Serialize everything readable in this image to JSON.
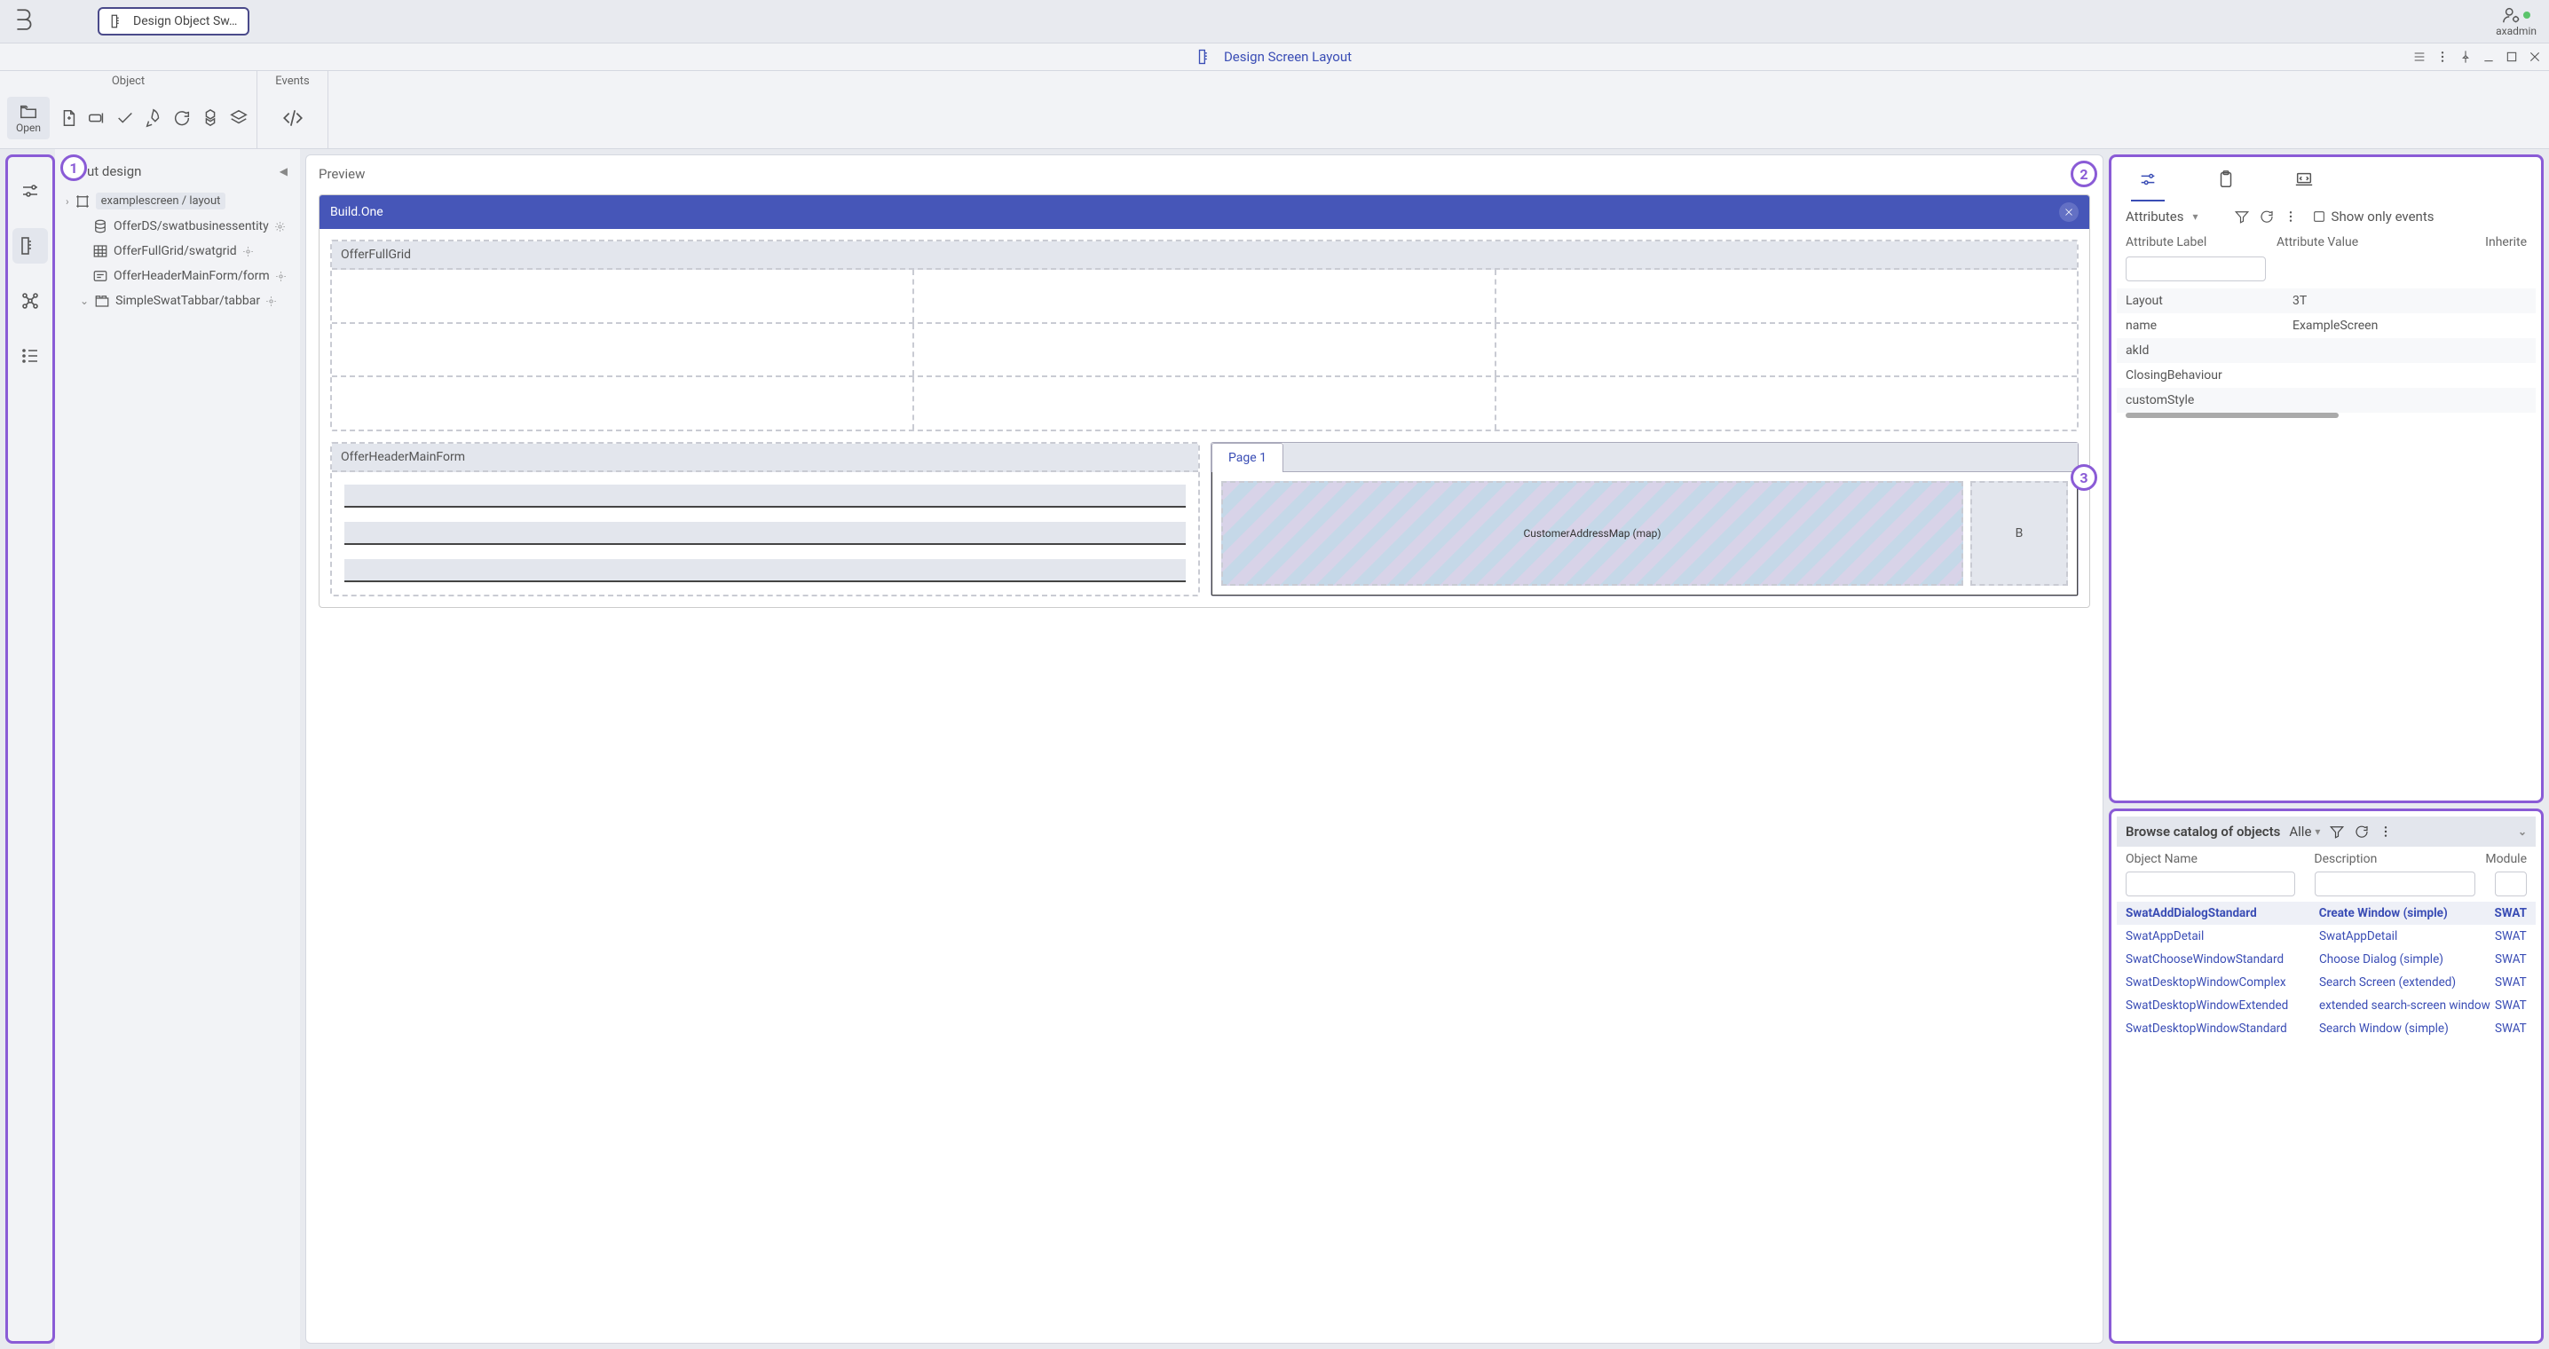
{
  "topbar": {
    "tab_label": "Design Object Sw…",
    "username": "axadmin"
  },
  "titlebar": {
    "title": "Design Screen Layout"
  },
  "ribbon": {
    "object_label": "Object",
    "open_label": "Open",
    "events_label": "Events"
  },
  "tree": {
    "header": "ut design",
    "nodes": [
      {
        "label": "examplescreen / layout"
      },
      {
        "label": "OfferDS/swatbusinessentity"
      },
      {
        "label": "OfferFullGrid/swatgrid"
      },
      {
        "label": "OfferHeaderMainForm/form"
      },
      {
        "label": "SimpleSwatTabbar/tabbar"
      }
    ]
  },
  "preview": {
    "title": "Preview",
    "window_title": "Build.One",
    "grid_title": "OfferFullGrid",
    "form_title": "OfferHeaderMainForm",
    "tab_label": "Page 1",
    "map_label": "CustomerAddressMap (map)",
    "b_label": "B"
  },
  "attributes": {
    "dropdown_label": "Attributes",
    "show_only_events": "Show only events",
    "col_label": "Attribute Label",
    "col_value": "Attribute Value",
    "col_inherited": "Inherite",
    "rows": [
      {
        "name": "Layout",
        "value": "3T"
      },
      {
        "name": "name",
        "value": "ExampleScreen"
      },
      {
        "name": "akId",
        "value": ""
      },
      {
        "name": "ClosingBehaviour",
        "value": ""
      },
      {
        "name": "customStyle",
        "value": ""
      }
    ]
  },
  "catalog": {
    "header": "Browse catalog of objects",
    "filter_label": "Alle",
    "col_name": "Object Name",
    "col_desc": "Description",
    "col_module": "Module",
    "rows": [
      {
        "name": "SwatAddDialogStandard",
        "desc": "Create Window (simple)",
        "module": "SWAT",
        "selected": true
      },
      {
        "name": "SwatAppDetail",
        "desc": "SwatAppDetail",
        "module": "SWAT"
      },
      {
        "name": "SwatChooseWindowStandard",
        "desc": "Choose Dialog (simple)",
        "module": "SWAT"
      },
      {
        "name": "SwatDesktopWindowComplex",
        "desc": "Search Screen (extended)",
        "module": "SWAT"
      },
      {
        "name": "SwatDesktopWindowExtended",
        "desc": "extended search-screen window",
        "module": "SWAT"
      },
      {
        "name": "SwatDesktopWindowStandard",
        "desc": "Search Window (simple)",
        "module": "SWAT"
      }
    ]
  },
  "annotations": {
    "a1": "1",
    "a2": "2",
    "a3": "3"
  }
}
